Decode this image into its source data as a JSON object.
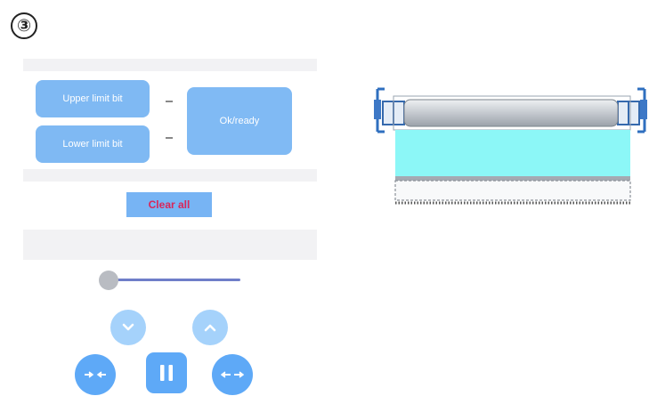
{
  "step": {
    "number": "③"
  },
  "limits": {
    "upper_label": "Upper limit bit",
    "lower_label": "Lower limit bit",
    "connector": "-",
    "ready_label": "Ok/ready"
  },
  "actions": {
    "clear_all_label": "Clear all"
  },
  "slider": {
    "value": 0
  },
  "icons": {
    "down": "chevron-down-icon",
    "up": "chevron-up-icon",
    "close": "arrows-inward-icon",
    "pause": "pause-icon",
    "open": "arrows-outward-icon"
  },
  "colors": {
    "button_fill": "#7fb9f3",
    "control_fill": "#5ea9f7",
    "control_light": "#a5d2fb",
    "clear_text": "#d9265a",
    "slider_track": "#6f7ec9",
    "fabric": "#8cf7f7",
    "tube": "#c9ced4"
  }
}
